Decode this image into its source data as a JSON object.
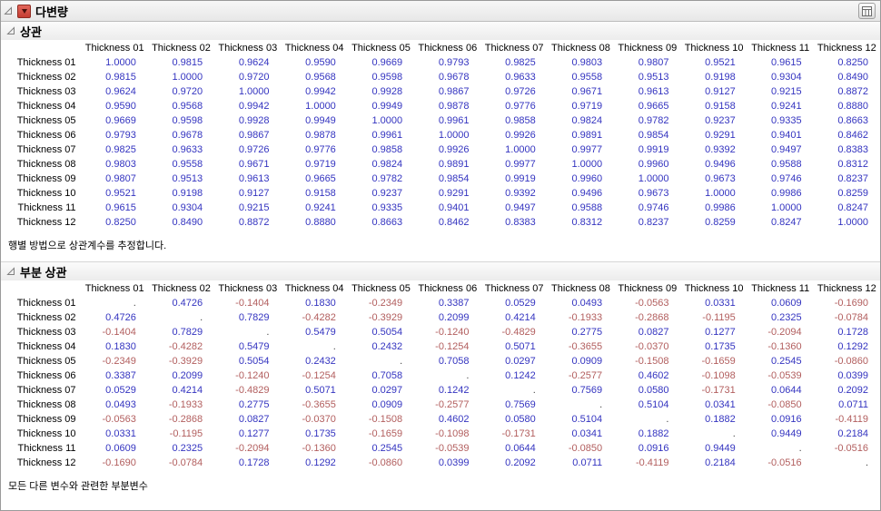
{
  "report": {
    "title": "다변량"
  },
  "sections": [
    {
      "title": "상관",
      "note": "행별 방법으로 상관계수를 추정합니다."
    },
    {
      "title": "부분 상관",
      "note": "모든 다른 변수와 관련한 부분변수"
    }
  ],
  "colors": {
    "positive_value": "#3434c0",
    "negative_value": "#b25e5e"
  },
  "icons": {
    "disclosure": "open-triangle",
    "red_menu": "red-triangle-down",
    "corner": "data-table-window"
  },
  "tables": [
    {
      "name": "correlations",
      "columns": [
        "Thickness 01",
        "Thickness 02",
        "Thickness 03",
        "Thickness 04",
        "Thickness 05",
        "Thickness 06",
        "Thickness 07",
        "Thickness 08",
        "Thickness 09",
        "Thickness 10",
        "Thickness 11",
        "Thickness 12"
      ],
      "rows": [
        {
          "label": "Thickness 01",
          "values": [
            "1.0000",
            "0.9815",
            "0.9624",
            "0.9590",
            "0.9669",
            "0.9793",
            "0.9825",
            "0.9803",
            "0.9807",
            "0.9521",
            "0.9615",
            "0.8250"
          ]
        },
        {
          "label": "Thickness 02",
          "values": [
            "0.9815",
            "1.0000",
            "0.9720",
            "0.9568",
            "0.9598",
            "0.9678",
            "0.9633",
            "0.9558",
            "0.9513",
            "0.9198",
            "0.9304",
            "0.8490"
          ]
        },
        {
          "label": "Thickness 03",
          "values": [
            "0.9624",
            "0.9720",
            "1.0000",
            "0.9942",
            "0.9928",
            "0.9867",
            "0.9726",
            "0.9671",
            "0.9613",
            "0.9127",
            "0.9215",
            "0.8872"
          ]
        },
        {
          "label": "Thickness 04",
          "values": [
            "0.9590",
            "0.9568",
            "0.9942",
            "1.0000",
            "0.9949",
            "0.9878",
            "0.9776",
            "0.9719",
            "0.9665",
            "0.9158",
            "0.9241",
            "0.8880"
          ]
        },
        {
          "label": "Thickness 05",
          "values": [
            "0.9669",
            "0.9598",
            "0.9928",
            "0.9949",
            "1.0000",
            "0.9961",
            "0.9858",
            "0.9824",
            "0.9782",
            "0.9237",
            "0.9335",
            "0.8663"
          ]
        },
        {
          "label": "Thickness 06",
          "values": [
            "0.9793",
            "0.9678",
            "0.9867",
            "0.9878",
            "0.9961",
            "1.0000",
            "0.9926",
            "0.9891",
            "0.9854",
            "0.9291",
            "0.9401",
            "0.8462"
          ]
        },
        {
          "label": "Thickness 07",
          "values": [
            "0.9825",
            "0.9633",
            "0.9726",
            "0.9776",
            "0.9858",
            "0.9926",
            "1.0000",
            "0.9977",
            "0.9919",
            "0.9392",
            "0.9497",
            "0.8383"
          ]
        },
        {
          "label": "Thickness 08",
          "values": [
            "0.9803",
            "0.9558",
            "0.9671",
            "0.9719",
            "0.9824",
            "0.9891",
            "0.9977",
            "1.0000",
            "0.9960",
            "0.9496",
            "0.9588",
            "0.8312"
          ]
        },
        {
          "label": "Thickness 09",
          "values": [
            "0.9807",
            "0.9513",
            "0.9613",
            "0.9665",
            "0.9782",
            "0.9854",
            "0.9919",
            "0.9960",
            "1.0000",
            "0.9673",
            "0.9746",
            "0.8237"
          ]
        },
        {
          "label": "Thickness 10",
          "values": [
            "0.9521",
            "0.9198",
            "0.9127",
            "0.9158",
            "0.9237",
            "0.9291",
            "0.9392",
            "0.9496",
            "0.9673",
            "1.0000",
            "0.9986",
            "0.8259"
          ]
        },
        {
          "label": "Thickness 11",
          "values": [
            "0.9615",
            "0.9304",
            "0.9215",
            "0.9241",
            "0.9335",
            "0.9401",
            "0.9497",
            "0.9588",
            "0.9746",
            "0.9986",
            "1.0000",
            "0.8247"
          ]
        },
        {
          "label": "Thickness 12",
          "values": [
            "0.8250",
            "0.8490",
            "0.8872",
            "0.8880",
            "0.8663",
            "0.8462",
            "0.8383",
            "0.8312",
            "0.8237",
            "0.8259",
            "0.8247",
            "1.0000"
          ]
        }
      ]
    },
    {
      "name": "partial_correlations",
      "columns": [
        "Thickness 01",
        "Thickness 02",
        "Thickness 03",
        "Thickness 04",
        "Thickness 05",
        "Thickness 06",
        "Thickness 07",
        "Thickness 08",
        "Thickness 09",
        "Thickness 10",
        "Thickness 11",
        "Thickness 12"
      ],
      "rows": [
        {
          "label": "Thickness 01",
          "values": [
            ".",
            "0.4726",
            "-0.1404",
            "0.1830",
            "-0.2349",
            "0.3387",
            "0.0529",
            "0.0493",
            "-0.0563",
            "0.0331",
            "0.0609",
            "-0.1690"
          ]
        },
        {
          "label": "Thickness 02",
          "values": [
            "0.4726",
            ".",
            "0.7829",
            "-0.4282",
            "-0.3929",
            "0.2099",
            "0.4214",
            "-0.1933",
            "-0.2868",
            "-0.1195",
            "0.2325",
            "-0.0784"
          ]
        },
        {
          "label": "Thickness 03",
          "values": [
            "-0.1404",
            "0.7829",
            ".",
            "0.5479",
            "0.5054",
            "-0.1240",
            "-0.4829",
            "0.2775",
            "0.0827",
            "0.1277",
            "-0.2094",
            "0.1728"
          ]
        },
        {
          "label": "Thickness 04",
          "values": [
            "0.1830",
            "-0.4282",
            "0.5479",
            ".",
            "0.2432",
            "-0.1254",
            "0.5071",
            "-0.3655",
            "-0.0370",
            "0.1735",
            "-0.1360",
            "0.1292"
          ]
        },
        {
          "label": "Thickness 05",
          "values": [
            "-0.2349",
            "-0.3929",
            "0.5054",
            "0.2432",
            ".",
            "0.7058",
            "0.0297",
            "0.0909",
            "-0.1508",
            "-0.1659",
            "0.2545",
            "-0.0860"
          ]
        },
        {
          "label": "Thickness 06",
          "values": [
            "0.3387",
            "0.2099",
            "-0.1240",
            "-0.1254",
            "0.7058",
            ".",
            "0.1242",
            "-0.2577",
            "0.4602",
            "-0.1098",
            "-0.0539",
            "0.0399"
          ]
        },
        {
          "label": "Thickness 07",
          "values": [
            "0.0529",
            "0.4214",
            "-0.4829",
            "0.5071",
            "0.0297",
            "0.1242",
            ".",
            "0.7569",
            "0.0580",
            "-0.1731",
            "0.0644",
            "0.2092"
          ]
        },
        {
          "label": "Thickness 08",
          "values": [
            "0.0493",
            "-0.1933",
            "0.2775",
            "-0.3655",
            "0.0909",
            "-0.2577",
            "0.7569",
            ".",
            "0.5104",
            "0.0341",
            "-0.0850",
            "0.0711"
          ]
        },
        {
          "label": "Thickness 09",
          "values": [
            "-0.0563",
            "-0.2868",
            "0.0827",
            "-0.0370",
            "-0.1508",
            "0.4602",
            "0.0580",
            "0.5104",
            ".",
            "0.1882",
            "0.0916",
            "-0.4119"
          ]
        },
        {
          "label": "Thickness 10",
          "values": [
            "0.0331",
            "-0.1195",
            "0.1277",
            "0.1735",
            "-0.1659",
            "-0.1098",
            "-0.1731",
            "0.0341",
            "0.1882",
            ".",
            "0.9449",
            "0.2184"
          ]
        },
        {
          "label": "Thickness 11",
          "values": [
            "0.0609",
            "0.2325",
            "-0.2094",
            "-0.1360",
            "0.2545",
            "-0.0539",
            "0.0644",
            "-0.0850",
            "0.0916",
            "0.9449",
            ".",
            "-0.0516"
          ]
        },
        {
          "label": "Thickness 12",
          "values": [
            "-0.1690",
            "-0.0784",
            "0.1728",
            "0.1292",
            "-0.0860",
            "0.0399",
            "0.2092",
            "0.0711",
            "-0.4119",
            "0.2184",
            "-0.0516",
            "."
          ]
        }
      ]
    }
  ]
}
